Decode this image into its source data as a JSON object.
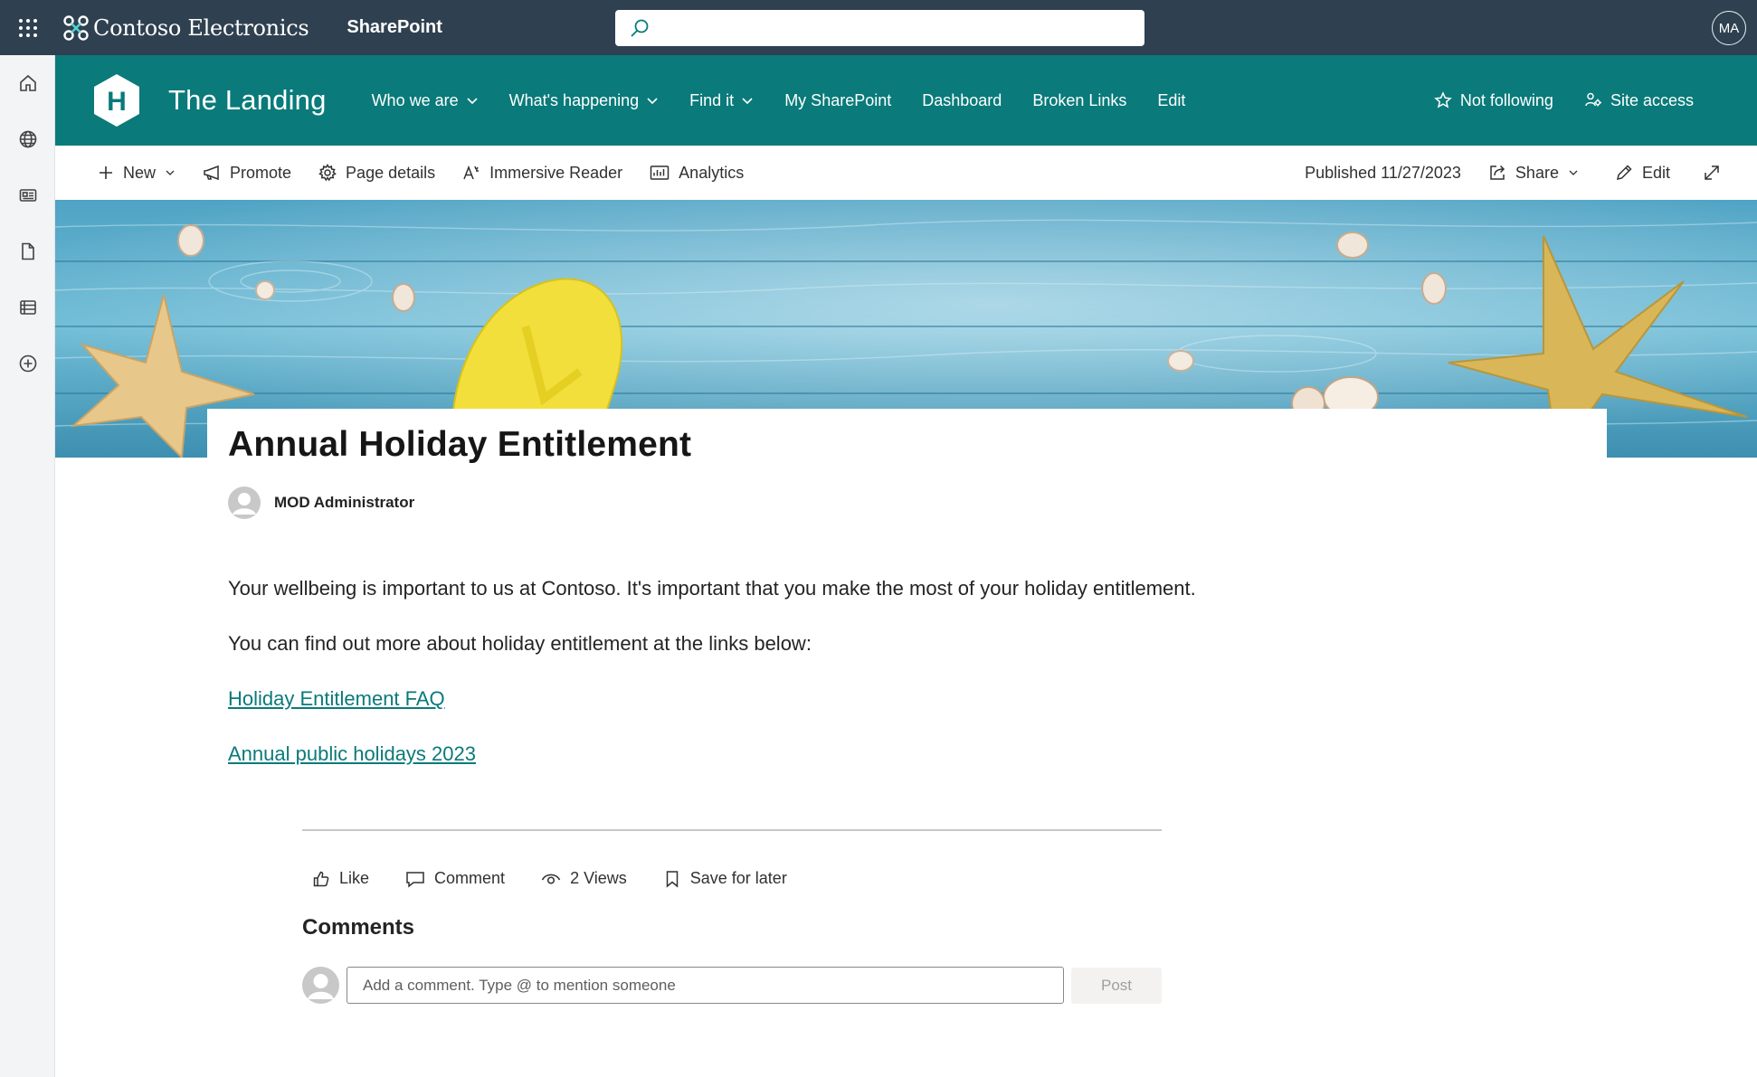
{
  "suitebar": {
    "org_name": "Contoso Electronics",
    "app_name": "SharePoint",
    "search_placeholder": "",
    "user_initials": "MA"
  },
  "site": {
    "logo_letter": "H",
    "title": "The Landing",
    "nav": [
      {
        "label": "Who we are",
        "has_dropdown": true
      },
      {
        "label": "What's happening",
        "has_dropdown": true
      },
      {
        "label": "Find it",
        "has_dropdown": true
      },
      {
        "label": "My SharePoint",
        "has_dropdown": false
      },
      {
        "label": "Dashboard",
        "has_dropdown": false
      },
      {
        "label": "Broken Links",
        "has_dropdown": false
      },
      {
        "label": "Edit",
        "has_dropdown": false
      }
    ],
    "follow_label": "Not following",
    "access_label": "Site access",
    "theme_color": "#0a7a7a"
  },
  "commandbar": {
    "new_label": "New",
    "promote_label": "Promote",
    "page_details_label": "Page details",
    "immersive_reader_label": "Immersive Reader",
    "analytics_label": "Analytics",
    "published": "Published 11/27/2023",
    "share_label": "Share",
    "edit_label": "Edit"
  },
  "page": {
    "title": "Annual Holiday Entitlement",
    "author": "MOD Administrator",
    "paragraphs": [
      "Your wellbeing is important to us at Contoso. It's important that you make the most of your holiday entitlement.",
      "You can find out more about holiday entitlement at the links below:"
    ],
    "links": [
      "Holiday Entitlement FAQ",
      "Annual public holidays 2023"
    ]
  },
  "social": {
    "like_label": "Like",
    "comment_label": "Comment",
    "views_label": "2 Views",
    "save_label": "Save for later"
  },
  "comments": {
    "heading": "Comments",
    "placeholder": "Add a comment. Type @ to mention someone",
    "post_label": "Post"
  }
}
